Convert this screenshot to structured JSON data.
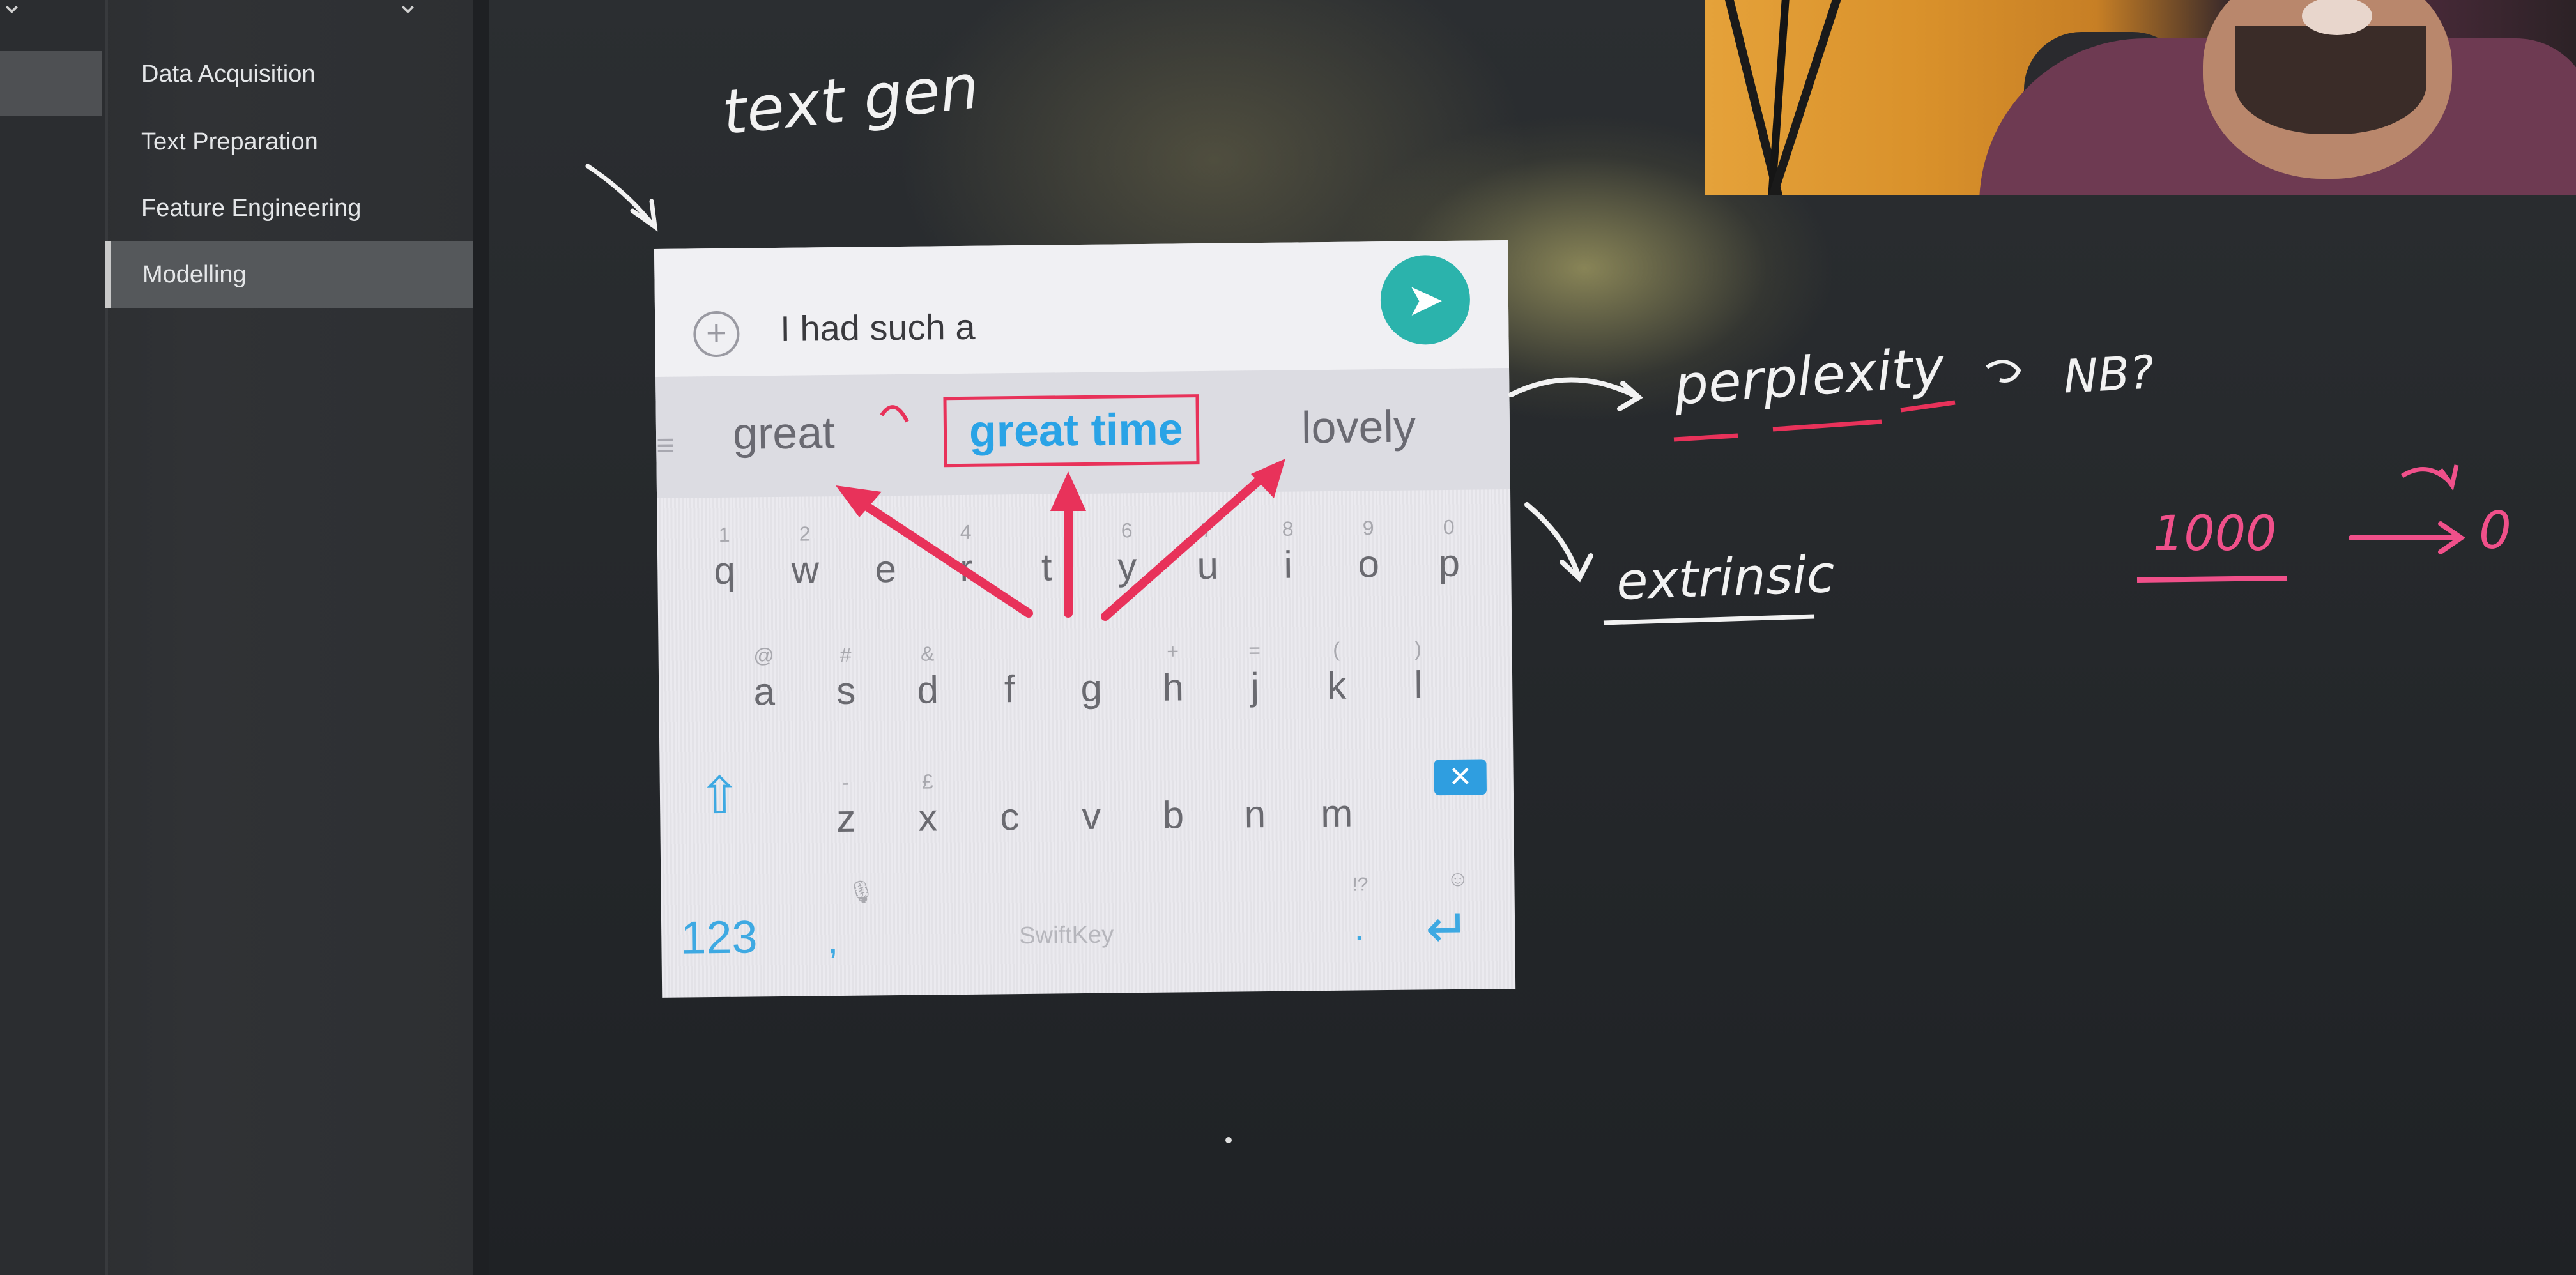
{
  "nav": {
    "items": [
      {
        "label": "Data Acquisition",
        "active": false
      },
      {
        "label": "Text Preparation",
        "active": false
      },
      {
        "label": "Feature Engineering",
        "active": false
      },
      {
        "label": "Modelling",
        "active": true
      }
    ]
  },
  "keyboard": {
    "input_text": "I had such a",
    "suggestions": {
      "left": "great",
      "center": "great time",
      "right": "lovely"
    },
    "rows": [
      [
        {
          "key": "q",
          "hint": "1"
        },
        {
          "key": "w",
          "hint": "2"
        },
        {
          "key": "e",
          "hint": ""
        },
        {
          "key": "r",
          "hint": "4"
        },
        {
          "key": "t",
          "hint": ""
        },
        {
          "key": "y",
          "hint": "6"
        },
        {
          "key": "u",
          "hint": "7"
        },
        {
          "key": "i",
          "hint": "8"
        },
        {
          "key": "o",
          "hint": "9"
        },
        {
          "key": "p",
          "hint": "0"
        }
      ],
      [
        {
          "key": "a",
          "hint": "@"
        },
        {
          "key": "s",
          "hint": "#"
        },
        {
          "key": "d",
          "hint": "&"
        },
        {
          "key": "f",
          "hint": ""
        },
        {
          "key": "g",
          "hint": ""
        },
        {
          "key": "h",
          "hint": "+"
        },
        {
          "key": "j",
          "hint": "="
        },
        {
          "key": "k",
          "hint": "("
        },
        {
          "key": "l",
          "hint": ")"
        }
      ],
      [
        {
          "key": "z",
          "hint": "-"
        },
        {
          "key": "x",
          "hint": "£"
        },
        {
          "key": "c",
          "hint": ""
        },
        {
          "key": "v",
          "hint": ""
        },
        {
          "key": "b",
          "hint": ""
        },
        {
          "key": "n",
          "hint": ""
        },
        {
          "key": "m",
          "hint": ""
        }
      ]
    ],
    "numbers_key": "123",
    "comma_key": ",",
    "period_key": ".",
    "period_hint": "!?",
    "brand": "SwiftKey",
    "icons": {
      "plus": "plus-circle-icon",
      "send": "send-icon",
      "shift": "shift-arrow-icon",
      "backspace": "backspace-icon",
      "enter": "enter-icon",
      "mic": "mic-icon",
      "menu": "menu-icon"
    },
    "colors": {
      "accent": "#2aa3e6",
      "send": "#2bb3ac",
      "annotation": "#e8325a"
    }
  },
  "annotations": {
    "text_gen": "text gen",
    "perplexity": "perplexity",
    "nbr": "NB?",
    "extrinsic": "extrinsic",
    "count": "1000",
    "zero": "0",
    "colors": {
      "chalk": "#f2f2f2",
      "pink": "#f0508a",
      "red": "#e8325a"
    }
  }
}
